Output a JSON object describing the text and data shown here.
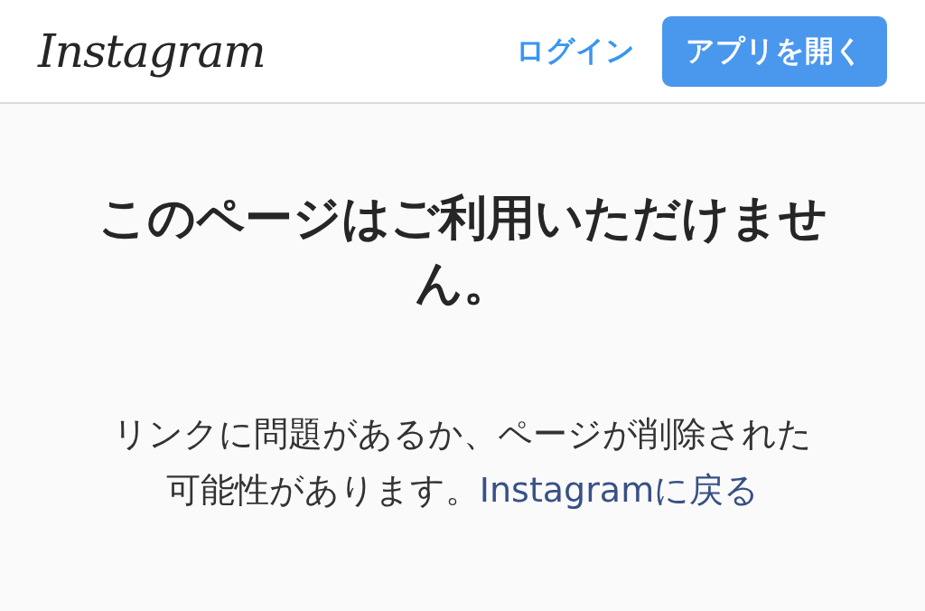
{
  "header": {
    "logo": "Instagram",
    "login_link": "ログイン",
    "open_app_button": "アプリを開く"
  },
  "error": {
    "title": "このページはご利用いただけません。",
    "message": "リンクに問題があるか、ページが削除された可能性があります。",
    "back_link": "Instagramに戻る"
  }
}
